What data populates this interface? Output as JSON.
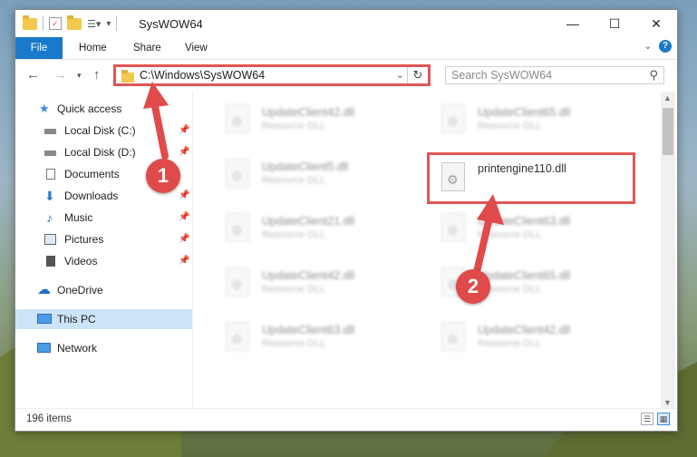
{
  "window": {
    "title": "SysWOW64"
  },
  "ribbon": {
    "tabs": [
      "File",
      "Home",
      "Share",
      "View"
    ]
  },
  "nav": {
    "address": "C:\\Windows\\SysWOW64",
    "search_placeholder": "Search SysWOW64"
  },
  "sidebar": {
    "items": [
      {
        "label": "Quick access",
        "icon": "star-icon"
      },
      {
        "label": "Local Disk (C:)",
        "icon": "drive-icon"
      },
      {
        "label": "Local Disk (D:)",
        "icon": "drive-icon"
      },
      {
        "label": "Documents",
        "icon": "documents-icon"
      },
      {
        "label": "Downloads",
        "icon": "download-arrow-icon"
      },
      {
        "label": "Music",
        "icon": "music-note-icon"
      },
      {
        "label": "Pictures",
        "icon": "pictures-icon"
      },
      {
        "label": "Videos",
        "icon": "film-icon"
      },
      {
        "label": "OneDrive",
        "icon": "cloud-icon"
      },
      {
        "label": "This PC",
        "icon": "monitor-icon"
      },
      {
        "label": "Network",
        "icon": "network-icon"
      }
    ]
  },
  "files": [
    {
      "name": "UpdateClient42.dll",
      "type": "Resource DLL"
    },
    {
      "name": "UpdateClient65.dll",
      "type": "Resource DLL"
    },
    {
      "name": "UpdateClient5.dll",
      "type": "Resource DLL"
    },
    {
      "name": "printengine110.dll",
      "type": ""
    },
    {
      "name": "UpdateClient21.dll",
      "type": "Resource DLL"
    },
    {
      "name": "UpdateClient63.dll",
      "type": "Resource DLL"
    },
    {
      "name": "UpdateClient42.dll",
      "type": "Resource DLL"
    },
    {
      "name": "UpdateClient65.dll",
      "type": "Resource DLL"
    },
    {
      "name": "UpdateClient63.dll",
      "type": "Resource DLL"
    },
    {
      "name": "UpdateClient42.dll",
      "type": "Resource DLL"
    }
  ],
  "status": {
    "item_count": "196 items"
  },
  "annotations": {
    "step1": "1",
    "step2": "2"
  },
  "colors": {
    "accent": "#1979ca",
    "highlight": "#e05656",
    "selected": "#cce4f7"
  }
}
